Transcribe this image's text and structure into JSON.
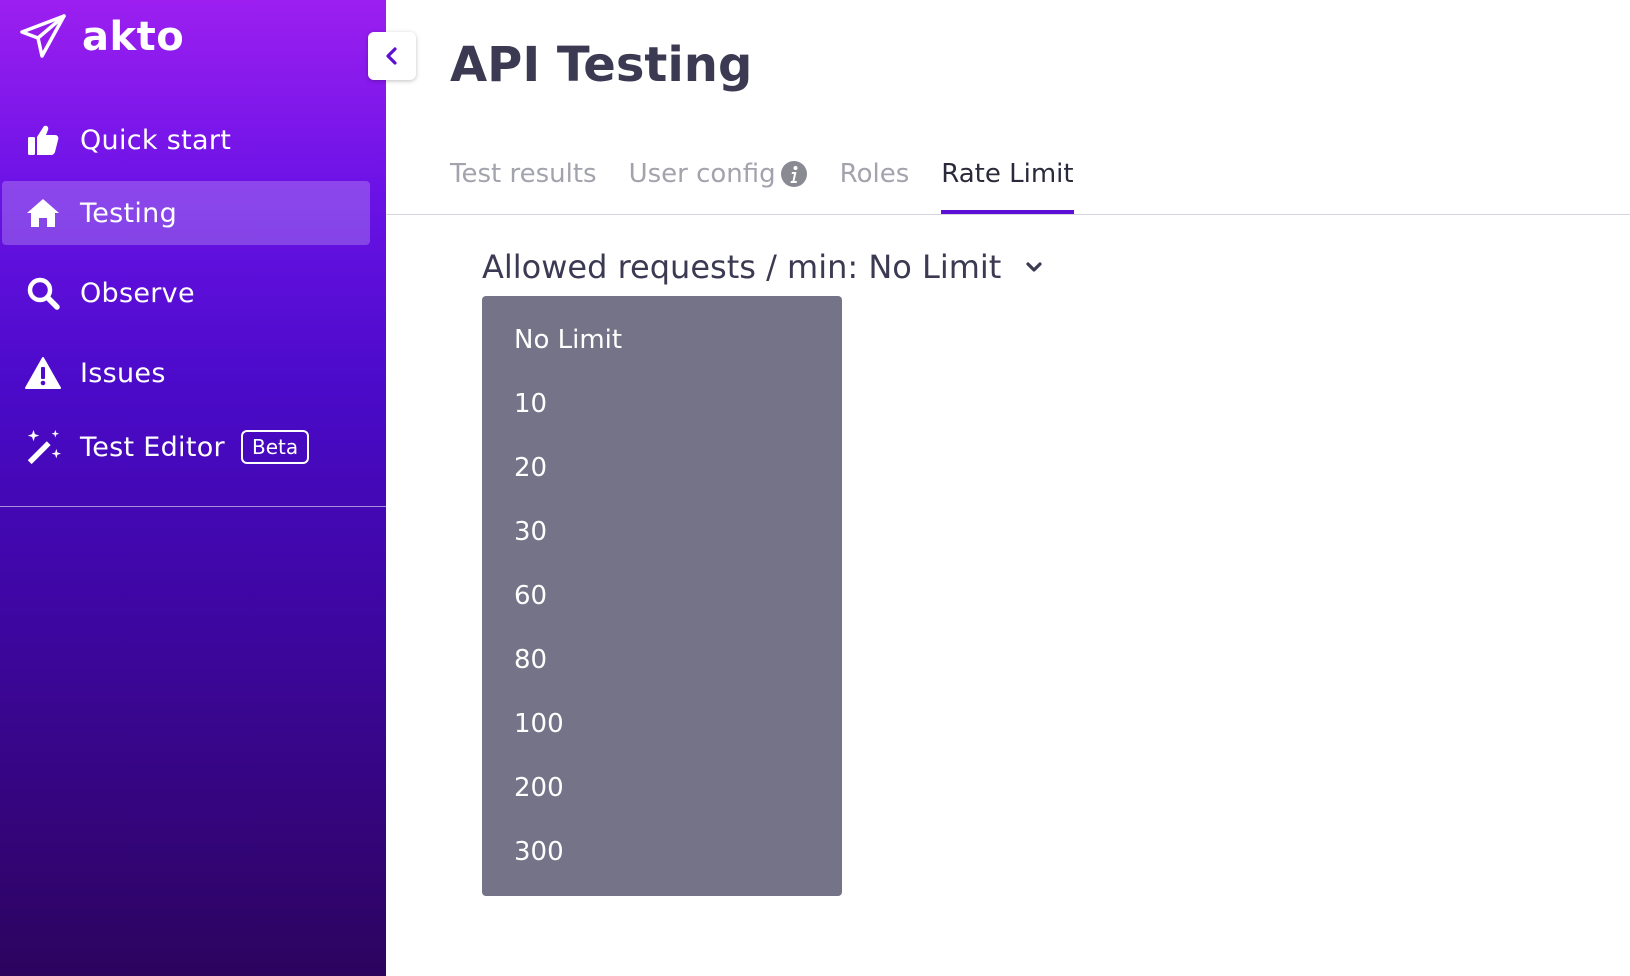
{
  "sidebar": {
    "logo_text": "akto",
    "items": [
      {
        "label": "Quick start",
        "icon": "thumbs-up-icon"
      },
      {
        "label": "Testing",
        "icon": "home-icon",
        "active": true
      },
      {
        "label": "Observe",
        "icon": "search-icon"
      },
      {
        "label": "Issues",
        "icon": "warning-icon"
      },
      {
        "label": "Test Editor",
        "icon": "magic-wand-icon",
        "badge": "Beta"
      }
    ]
  },
  "header": {
    "title": "API Testing"
  },
  "tabs": [
    {
      "label": "Test results"
    },
    {
      "label": "User config",
      "icon": "info-icon"
    },
    {
      "label": "Roles"
    },
    {
      "label": "Rate Limit",
      "active": true
    }
  ],
  "rate_limit": {
    "label": "Allowed requests / min: No Limit",
    "options": [
      "No Limit",
      "10",
      "20",
      "30",
      "60",
      "80",
      "100",
      "200",
      "300"
    ]
  },
  "colors": {
    "accent": "#5c10d6",
    "sidebar_top": "#9c1ff0",
    "sidebar_bottom": "#2c045e",
    "dropdown_bg": "#747388",
    "title_text": "#3b3a52"
  }
}
